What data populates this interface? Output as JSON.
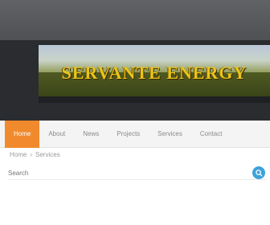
{
  "top_bar": {
    "line1": "",
    "line2": ""
  },
  "banner": {
    "title": "SERVANTE ENERGY"
  },
  "nav": {
    "items": [
      {
        "label": "Home"
      },
      {
        "label": "About"
      },
      {
        "label": "News"
      },
      {
        "label": "Projects"
      },
      {
        "label": "Services"
      },
      {
        "label": "Contact"
      }
    ]
  },
  "breadcrumb": {
    "items": [
      "Home",
      "Services"
    ]
  },
  "search": {
    "value": "",
    "placeholder": "Search"
  },
  "colors": {
    "top_bar": "#55575b",
    "header_band": "#2a2c2f",
    "nav_active": "#f08a2c",
    "search_button": "#3ea3dc",
    "banner_text": "#e8c51e"
  },
  "icons": {
    "search": "search-icon"
  }
}
